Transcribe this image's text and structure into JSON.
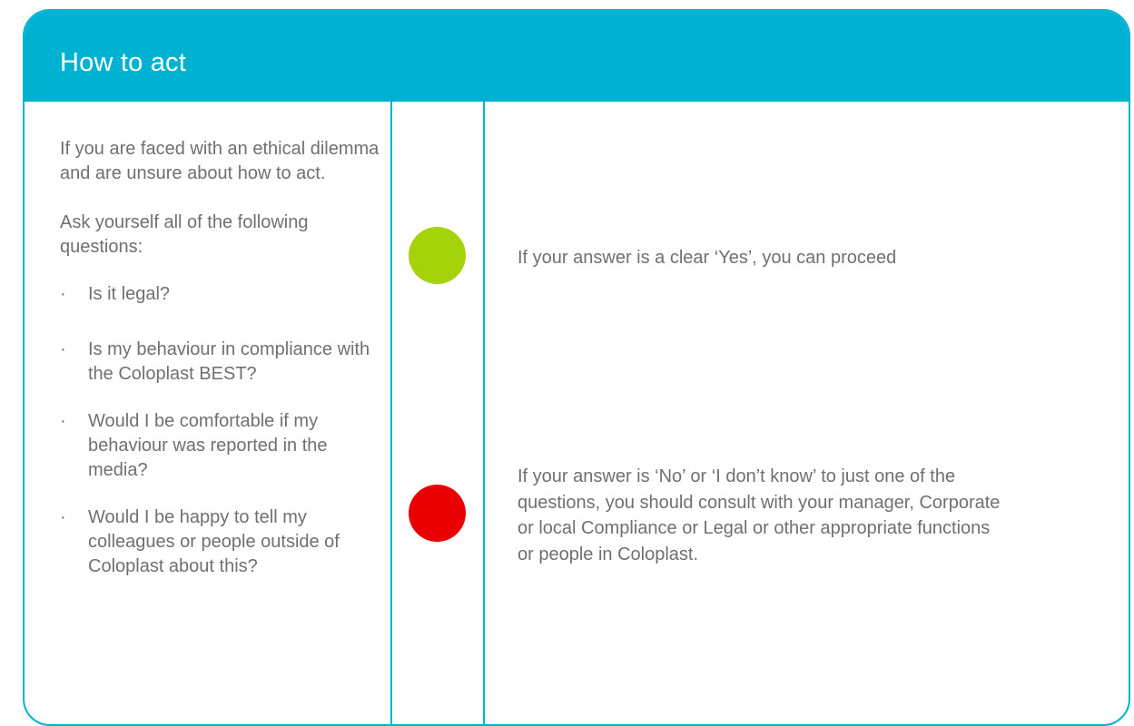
{
  "header": {
    "title": "How to act"
  },
  "left": {
    "intro": "If you are faced with an ethical dilemma and are unsure about how to act.",
    "ask": "Ask yourself all of the following questions:",
    "bullet": "·",
    "questions": [
      "Is it legal?",
      "Is my behaviour in compliance with the Coloplast BEST?",
      "Would I be comfortable if my behaviour was reported in the media?",
      "Would I be happy to tell my colleagues or people outside of Coloplast about this?"
    ]
  },
  "answers": {
    "yes": "If your answer is a clear ‘Yes’, you can proceed",
    "no": "If your answer is ‘No’ or ‘I don’t know’ to just one of the questions, you should consult with your manager, Corporate or local Compliance or Legal or other appropriate functions or people in Coloplast."
  },
  "colors": {
    "accent": "#00b2d1",
    "green_indicator": "#a5d30a",
    "red_indicator": "#ea0000",
    "text": "#707070"
  },
  "icons": {
    "green": "green-circle-icon",
    "red": "red-circle-icon"
  }
}
